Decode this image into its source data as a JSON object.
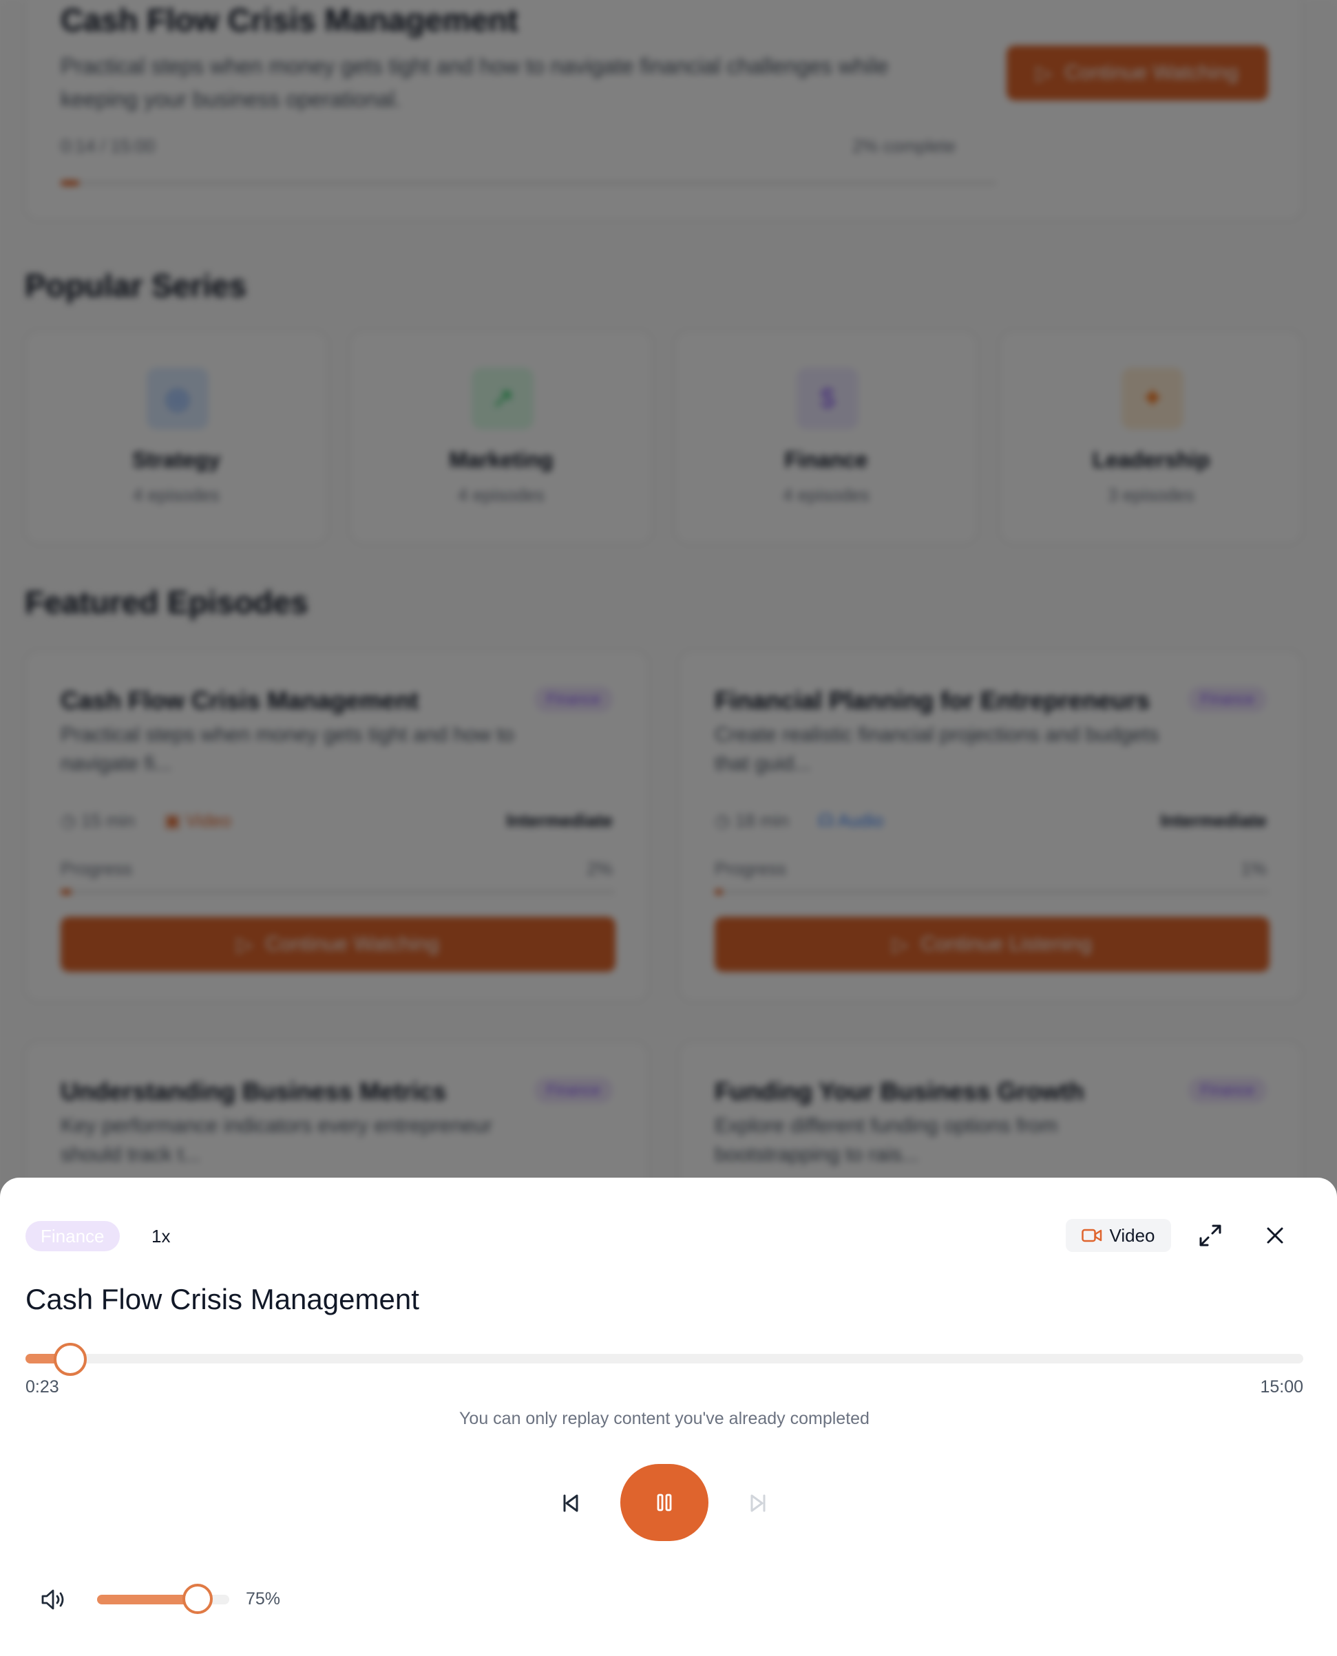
{
  "background": {
    "current": {
      "title": "Cash Flow Crisis Management",
      "description_line1": "Practical steps when money gets tight and how to navigate financial challenges while",
      "description_line2": "keeping your business operational.",
      "time": "0:14 / 15:00",
      "complete": "2% complete",
      "button": "Continue Watching",
      "progress_percent": 2
    },
    "popular_heading": "Popular Series",
    "series": [
      {
        "name": "Strategy",
        "count": "4 episodes",
        "icon": "target-icon",
        "color": "#3b82f6",
        "bg": "#dbeafe"
      },
      {
        "name": "Marketing",
        "count": "4 episodes",
        "icon": "chart-icon",
        "color": "#22c55e",
        "bg": "#dcfce7"
      },
      {
        "name": "Finance",
        "count": "4 episodes",
        "icon": "dollar-icon",
        "color": "#8b5cf6",
        "bg": "#ede9fe"
      },
      {
        "name": "Leadership",
        "count": "3 episodes",
        "icon": "star-icon",
        "color": "#f97316",
        "bg": "#ffedd5"
      }
    ],
    "featured_heading": "Featured Episodes",
    "episodes": [
      {
        "title": "Cash Flow Crisis Management",
        "tag": "Finance",
        "desc1": "Practical steps when money gets tight and how to",
        "desc2": "navigate fi...",
        "duration": "15 min",
        "type": "Video",
        "level": "Intermediate",
        "progress_label": "Progress",
        "progress_value": "2%",
        "progress_percent": 2,
        "button": "Continue Watching"
      },
      {
        "title": "Financial Planning for Entrepreneurs",
        "tag": "Finance",
        "desc1": "Create realistic financial projections and budgets",
        "desc2": "that guid...",
        "duration": "18 min",
        "type": "Audio",
        "level": "Intermediate",
        "progress_label": "Progress",
        "progress_value": "1%",
        "progress_percent": 1,
        "button": "Continue Listening"
      },
      {
        "title": "Understanding Business Metrics",
        "tag": "Finance",
        "desc1": "Key performance indicators every entrepreneur",
        "desc2": "should track t..."
      },
      {
        "title": "Funding Your Business Growth",
        "tag": "Finance",
        "desc1": "Explore different funding options from",
        "desc2": "bootstrapping to rais..."
      }
    ]
  },
  "player": {
    "category": "Finance",
    "speed": "1x",
    "media_type": "Video",
    "title": "Cash Flow Crisis Management",
    "elapsed": "0:23",
    "total": "15:00",
    "progress_percent": 3.5,
    "replay_note": "You can only replay content you've already completed",
    "volume_percent": 75,
    "volume_label": "75%",
    "accent_color": "#df642d"
  }
}
